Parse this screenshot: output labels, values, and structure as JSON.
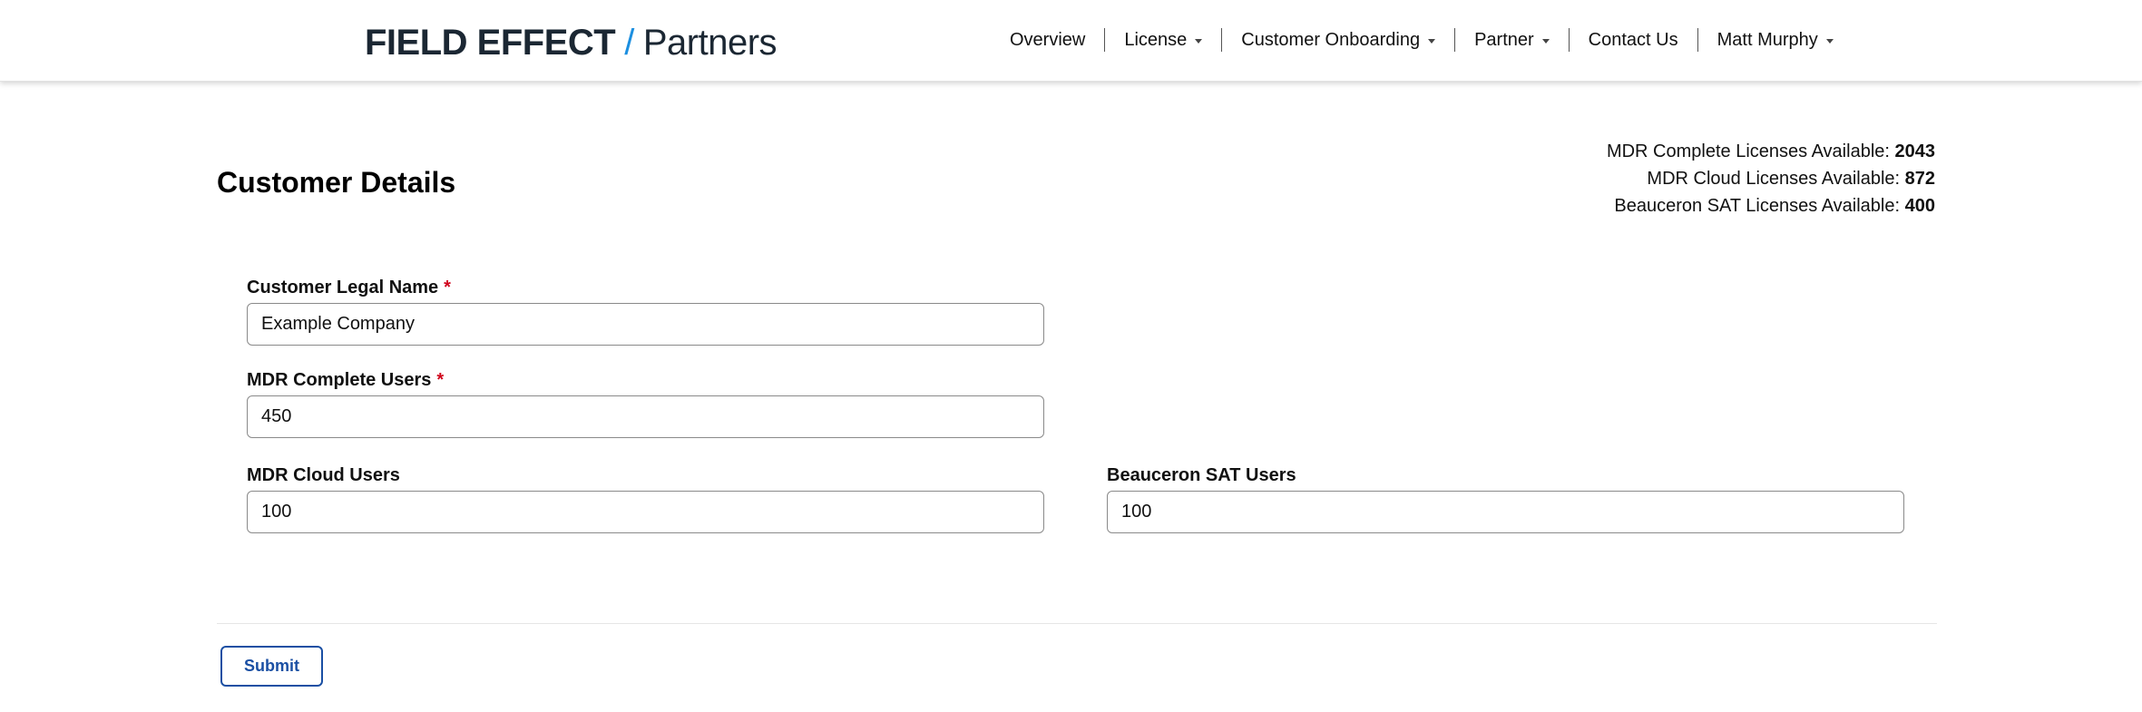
{
  "header": {
    "brand": "FIELD EFFECT",
    "slash": "/",
    "subbrand": "Partners",
    "accent_color": "#1c8fe0",
    "nav": [
      {
        "label": "Overview",
        "dropdown": false
      },
      {
        "label": "License",
        "dropdown": true
      },
      {
        "label": "Customer Onboarding",
        "dropdown": true
      },
      {
        "label": "Partner",
        "dropdown": true
      },
      {
        "label": "Contact Us",
        "dropdown": false
      },
      {
        "label": "Matt Murphy",
        "dropdown": true
      }
    ]
  },
  "page": {
    "title": "Customer Details"
  },
  "licenses": [
    {
      "label": "MDR Complete Licenses Available: ",
      "value": "2043"
    },
    {
      "label": "MDR Cloud Licenses Available: ",
      "value": "872"
    },
    {
      "label": "Beauceron SAT Licenses Available: ",
      "value": "400"
    }
  ],
  "form": {
    "required_marker": "*",
    "customer_legal_name": {
      "label": "Customer Legal Name",
      "value": "Example Company",
      "required": true
    },
    "mdr_complete_users": {
      "label": "MDR Complete Users",
      "value": "450",
      "required": true
    },
    "mdr_cloud_users": {
      "label": "MDR Cloud Users",
      "value": "100",
      "required": false
    },
    "beauceron_sat_users": {
      "label": "Beauceron SAT Users",
      "value": "100",
      "required": false
    },
    "submit_label": "Submit",
    "submit_color": "#1a4fa3",
    "required_color": "#d0021b"
  }
}
